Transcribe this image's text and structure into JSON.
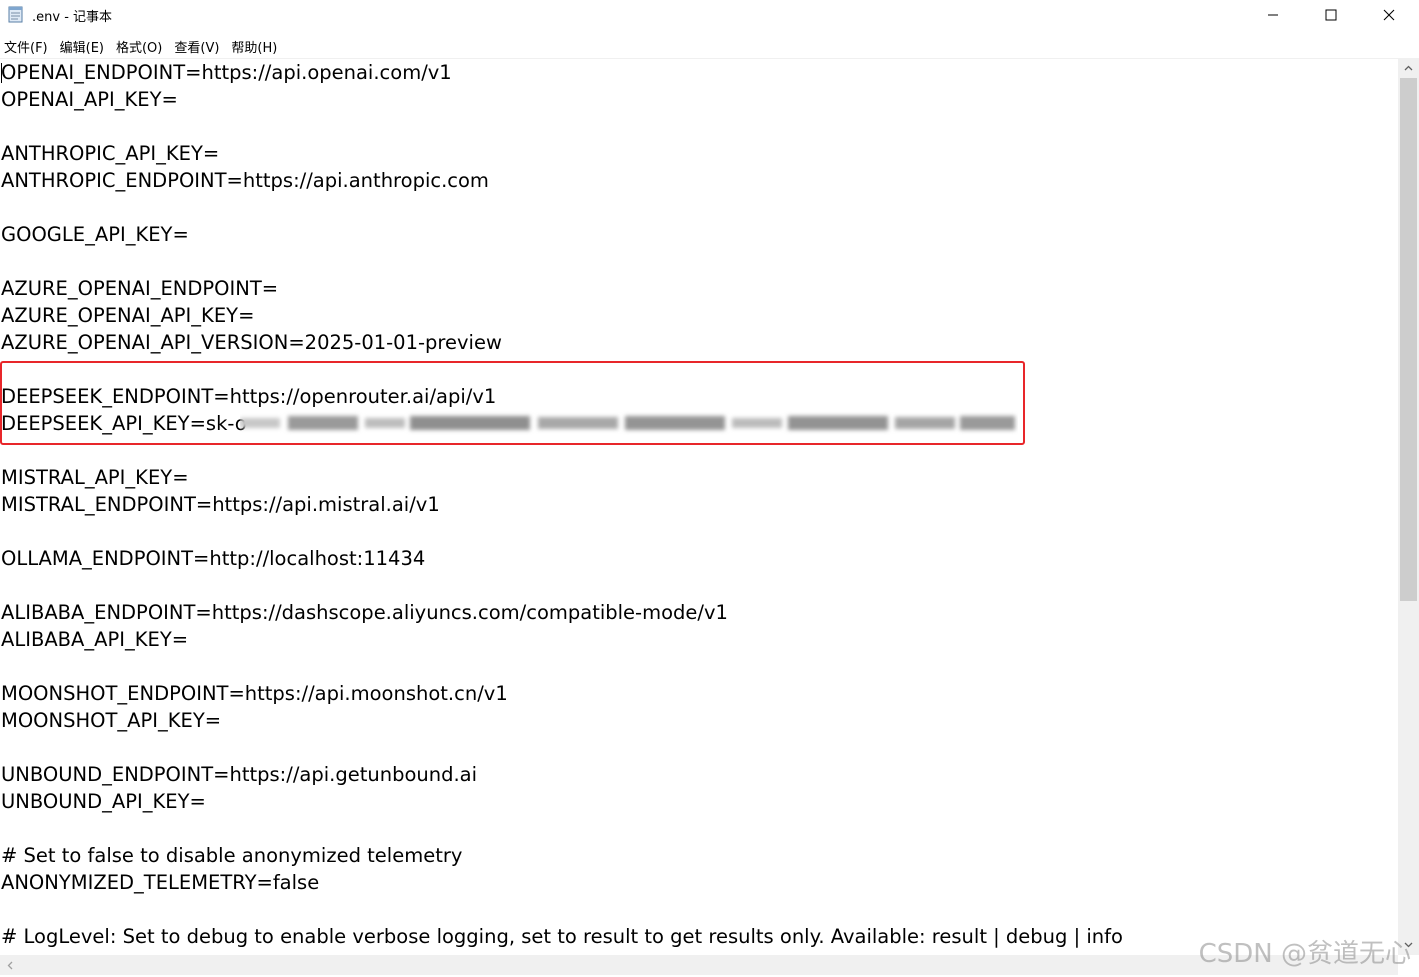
{
  "window": {
    "title": ".env - 记事本",
    "icon": "notepad-icon",
    "controls": {
      "minimize_icon": "minimize-icon",
      "maximize_icon": "maximize-icon",
      "close_icon": "close-icon"
    }
  },
  "menu": {
    "items": [
      {
        "label": "文件(F)"
      },
      {
        "label": "编辑(E)"
      },
      {
        "label": "格式(O)"
      },
      {
        "label": "查看(V)"
      },
      {
        "label": "帮助(H)"
      }
    ]
  },
  "editor": {
    "lines": [
      "OPENAI_ENDPOINT=https://api.openai.com/v1",
      "OPENAI_API_KEY=",
      "",
      "ANTHROPIC_API_KEY=",
      "ANTHROPIC_ENDPOINT=https://api.anthropic.com",
      "",
      "GOOGLE_API_KEY=",
      "",
      "AZURE_OPENAI_ENDPOINT=",
      "AZURE_OPENAI_API_KEY=",
      "AZURE_OPENAI_API_VERSION=2025-01-01-preview",
      "",
      "DEEPSEEK_ENDPOINT=https://openrouter.ai/api/v1",
      "DEEPSEEK_API_KEY=sk-o",
      "",
      "MISTRAL_API_KEY=",
      "MISTRAL_ENDPOINT=https://api.mistral.ai/v1",
      "",
      "OLLAMA_ENDPOINT=http://localhost:11434",
      "",
      "ALIBABA_ENDPOINT=https://dashscope.aliyuncs.com/compatible-mode/v1",
      "ALIBABA_API_KEY=",
      "",
      "MOONSHOT_ENDPOINT=https://api.moonshot.cn/v1",
      "MOONSHOT_API_KEY=",
      "",
      "UNBOUND_ENDPOINT=https://api.getunbound.ai",
      "UNBOUND_API_KEY=",
      "",
      "# Set to false to disable anonymized telemetry",
      "ANONYMIZED_TELEMETRY=false",
      "",
      "# LogLevel: Set to debug to enable verbose logging, set to result to get results only. Available: result | debug | info"
    ],
    "highlight_color": "#e8262a"
  },
  "watermark": "CSDN @贫道无心"
}
